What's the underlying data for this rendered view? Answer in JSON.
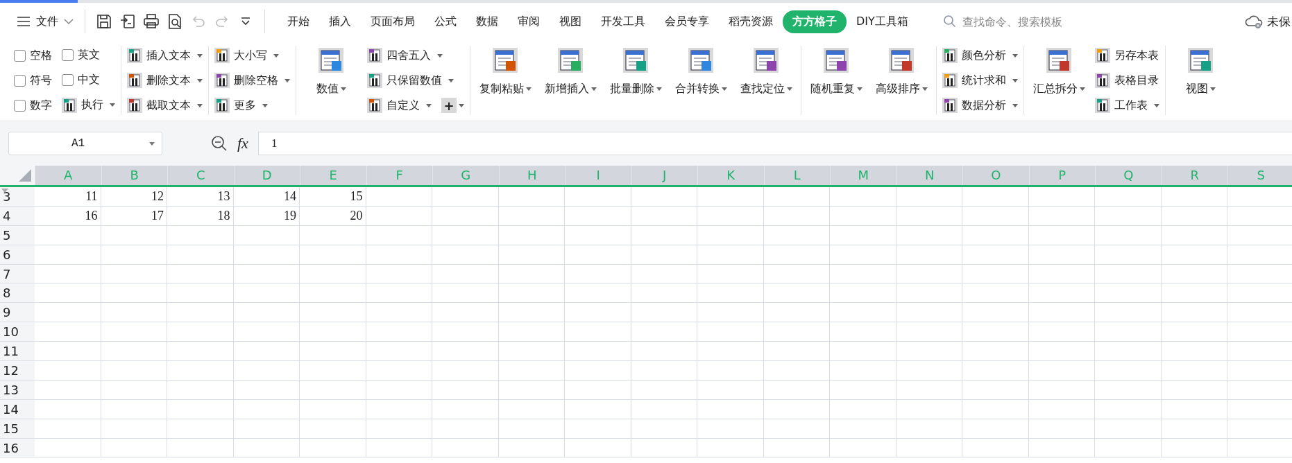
{
  "progress": {
    "level": 0.06
  },
  "menu": {
    "file": "文件",
    "quick_access": [
      {
        "kind": "save",
        "disabled": false
      },
      {
        "kind": "export",
        "disabled": false
      },
      {
        "kind": "print",
        "disabled": false
      },
      {
        "kind": "preview",
        "disabled": false
      },
      {
        "kind": "undo",
        "disabled": true
      },
      {
        "kind": "redo",
        "disabled": true
      },
      {
        "kind": "more",
        "disabled": false
      }
    ],
    "tabs": [
      {
        "label": "开始",
        "selected": false
      },
      {
        "label": "插入",
        "selected": false
      },
      {
        "label": "页面布局",
        "selected": false
      },
      {
        "label": "公式",
        "selected": false
      },
      {
        "label": "数据",
        "selected": false
      },
      {
        "label": "审阅",
        "selected": false
      },
      {
        "label": "视图",
        "selected": false
      },
      {
        "label": "开发工具",
        "selected": false
      },
      {
        "label": "会员专享",
        "selected": false
      },
      {
        "label": "稻壳资源",
        "selected": false
      },
      {
        "label": "方方格子",
        "selected": true
      },
      {
        "label": "DIY工具箱",
        "selected": false
      }
    ],
    "search": {
      "placeholder": "查找命令、搜索模板"
    },
    "save_status": "未保"
  },
  "ribbon": [
    {
      "columns": [
        {
          "kind": "stack",
          "items": [
            {
              "kind": "check",
              "label": "空格",
              "checked": false
            },
            {
              "kind": "check",
              "label": "符号",
              "checked": false
            },
            {
              "kind": "check",
              "label": "数字",
              "checked": false
            }
          ]
        },
        {
          "kind": "stack",
          "items": [
            {
              "kind": "check",
              "label": "英文",
              "checked": false
            },
            {
              "kind": "check",
              "label": "中文",
              "checked": false
            },
            {
              "kind": "tool",
              "label": "执行",
              "dropdown": true
            }
          ]
        }
      ]
    },
    {
      "columns": [
        {
          "kind": "stack",
          "items": [
            {
              "kind": "tool",
              "label": "插入文本",
              "dropdown": true
            },
            {
              "kind": "tool",
              "label": "删除文本",
              "dropdown": true
            },
            {
              "kind": "tool",
              "label": "截取文本",
              "dropdown": true
            }
          ]
        }
      ]
    },
    {
      "columns": [
        {
          "kind": "stack",
          "items": [
            {
              "kind": "tool",
              "label": "大小写",
              "dropdown": true
            },
            {
              "kind": "tool",
              "label": "删除空格",
              "dropdown": true
            },
            {
              "kind": "tool",
              "label": "更多",
              "dropdown": true
            }
          ]
        }
      ]
    },
    {
      "columns": [
        {
          "kind": "large",
          "label": "数值",
          "dropdown": true
        },
        {
          "kind": "stack",
          "items": [
            {
              "kind": "tool",
              "label": "四舍五入",
              "dropdown": true
            },
            {
              "kind": "tool",
              "label": "只保留数值",
              "dropdown": true
            },
            {
              "kind": "tool",
              "label": "自定义",
              "dropdown": true,
              "addon": {
                "label": "+",
                "dropdown": true
              }
            }
          ]
        }
      ]
    },
    {
      "columns": [
        {
          "kind": "large",
          "label": "复制粘贴",
          "dropdown": true
        },
        {
          "kind": "large",
          "label": "新增插入",
          "dropdown": true
        },
        {
          "kind": "large",
          "label": "批量删除",
          "dropdown": true
        },
        {
          "kind": "large",
          "label": "合并转换",
          "dropdown": true
        },
        {
          "kind": "large",
          "label": "查找定位",
          "dropdown": true
        }
      ]
    },
    {
      "columns": [
        {
          "kind": "large",
          "label": "随机重复",
          "dropdown": true
        },
        {
          "kind": "large",
          "label": "高级排序",
          "dropdown": true
        }
      ]
    },
    {
      "columns": [
        {
          "kind": "stack",
          "items": [
            {
              "kind": "tool",
              "label": "颜色分析",
              "dropdown": true
            },
            {
              "kind": "tool",
              "label": "统计求和",
              "dropdown": true
            },
            {
              "kind": "tool",
              "label": "数据分析",
              "dropdown": true
            }
          ]
        }
      ]
    },
    {
      "columns": [
        {
          "kind": "large",
          "label": "汇总拆分",
          "dropdown": true
        },
        {
          "kind": "stack",
          "items": [
            {
              "kind": "tool",
              "label": "另存本表",
              "dropdown": false
            },
            {
              "kind": "tool",
              "label": "表格目录",
              "dropdown": false
            },
            {
              "kind": "tool",
              "label": "工作表",
              "dropdown": true
            }
          ]
        }
      ]
    },
    {
      "columns": [
        {
          "kind": "large",
          "label": "视图",
          "dropdown": true
        }
      ]
    }
  ],
  "formula_bar": {
    "cell_ref": "A1",
    "fx": "fx",
    "value": "1"
  },
  "sheet": {
    "columns": [
      "A",
      "B",
      "C",
      "D",
      "E",
      "F",
      "G",
      "H",
      "I",
      "J",
      "K",
      "L",
      "M",
      "N",
      "O",
      "P",
      "Q",
      "R",
      "S"
    ],
    "rows": [
      {
        "header": "3",
        "cells": [
          "11",
          "12",
          "13",
          "14",
          "15"
        ]
      },
      {
        "header": "4",
        "cells": [
          "16",
          "17",
          "18",
          "19",
          "20"
        ]
      },
      {
        "header": "5",
        "cells": []
      },
      {
        "header": "6",
        "cells": []
      },
      {
        "header": "7",
        "cells": []
      },
      {
        "header": "8",
        "cells": []
      },
      {
        "header": "9",
        "cells": []
      },
      {
        "header": "10",
        "cells": []
      },
      {
        "header": "11",
        "cells": []
      },
      {
        "header": "12",
        "cells": []
      },
      {
        "header": "13",
        "cells": []
      },
      {
        "header": "14",
        "cells": []
      },
      {
        "header": "15",
        "cells": []
      },
      {
        "header": "16",
        "cells": []
      }
    ]
  }
}
